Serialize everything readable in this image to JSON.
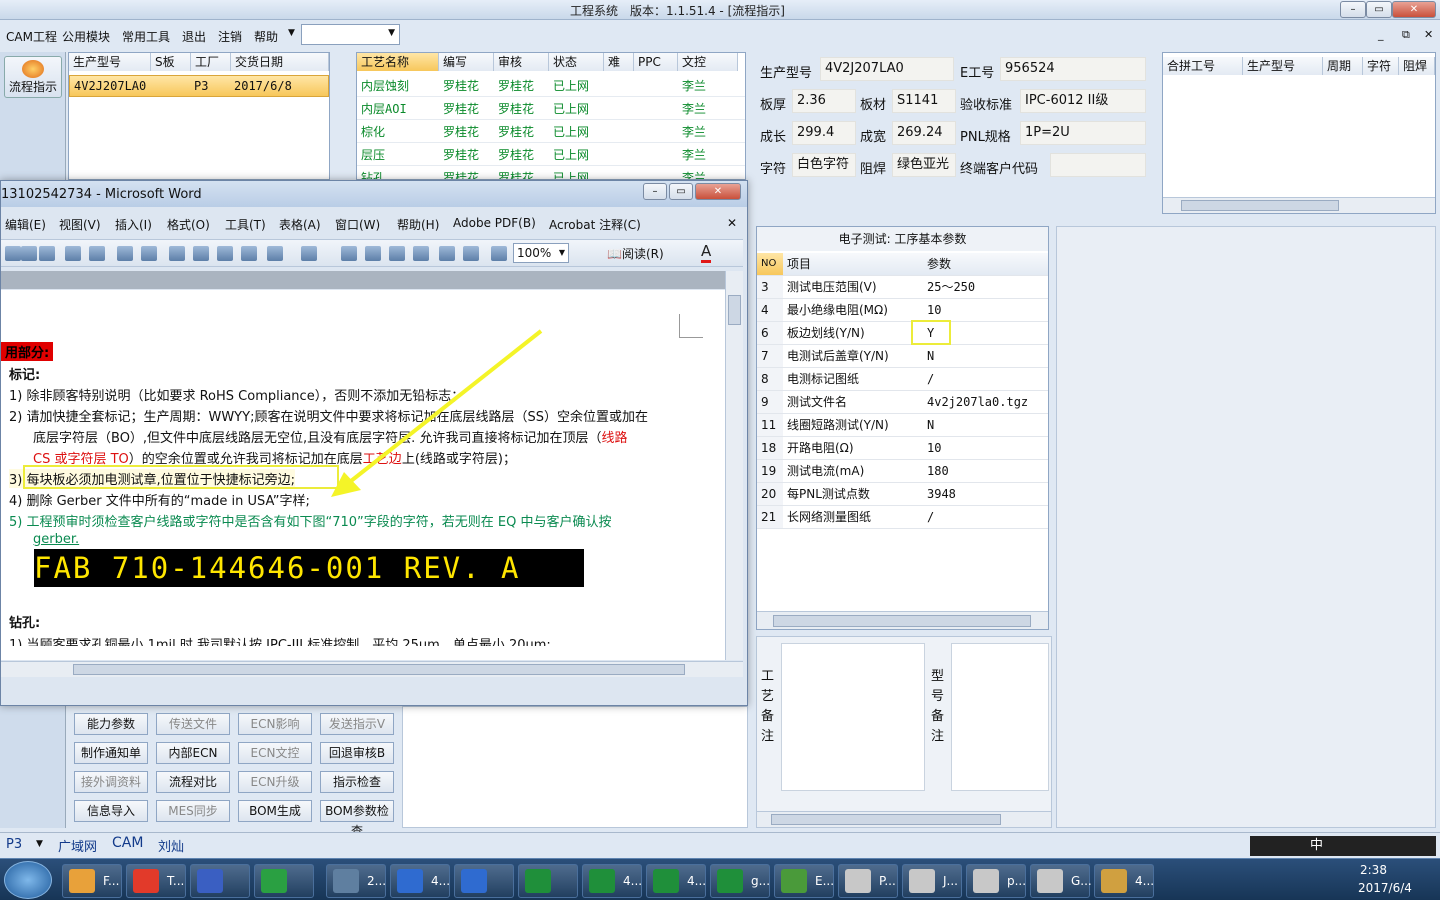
{
  "app": {
    "title": "工程系统　版本：1.1.51.4 - [流程指示]"
  },
  "menu": [
    "CAM工程",
    "公用模块",
    "常用工具",
    "退出",
    "注销",
    "帮助"
  ],
  "left_tool": {
    "flow_button": "流程指示"
  },
  "order_list": {
    "headers": [
      "生产型号",
      "S板",
      "工厂",
      "交货日期"
    ],
    "rows": [
      [
        "4V2J207LA0",
        "",
        "P3",
        "2017/6/8"
      ]
    ]
  },
  "process_list": {
    "headers": [
      "工艺名称",
      "编写",
      "审核",
      "状态",
      "难",
      "PPC",
      "文控"
    ],
    "rows": [
      [
        "内层蚀刻",
        "罗桂花",
        "罗桂花",
        "已上网",
        "",
        "",
        "李兰"
      ],
      [
        "内层AOI",
        "罗桂花",
        "罗桂花",
        "已上网",
        "",
        "",
        "李兰"
      ],
      [
        "棕化",
        "罗桂花",
        "罗桂花",
        "已上网",
        "",
        "",
        "李兰"
      ],
      [
        "层压",
        "罗桂花",
        "罗桂花",
        "已上网",
        "",
        "",
        "李兰"
      ],
      [
        "钻孔",
        "罗桂花",
        "罗桂花",
        "已上网",
        "",
        "",
        "李兰"
      ]
    ]
  },
  "info": {
    "model_label": "生产型号",
    "model": "4V2J207LA0",
    "eno_label": "E工号",
    "eno": "956524",
    "thick_label": "板厚",
    "thick": "2.36",
    "material_label": "板材",
    "material": "S1141",
    "std_label": "验收标准",
    "std": "IPC-6012 II级",
    "len_label": "成长",
    "len": "299.4",
    "wid_label": "成宽",
    "wid": "269.24",
    "pnl_label": "PNL规格",
    "pnl": "1P=2U",
    "char_label": "字符",
    "char": "白色字符",
    "mask_label": "阻焊",
    "mask": "绿色亚光",
    "cust_label": "终端客户代码",
    "cust": ""
  },
  "merge_list": {
    "headers": [
      "合拼工号",
      "生产型号",
      "周期",
      "字符",
      "阻焊"
    ]
  },
  "params": {
    "title": "电子测试: 工序基本参数",
    "headers": [
      "NO",
      "项目",
      "参数"
    ],
    "rows": [
      [
        "3",
        "测试电压范围(V)",
        "25～250"
      ],
      [
        "4",
        "最小绝缘电阻(MΩ)",
        "10"
      ],
      [
        "6",
        "板边划线(Y/N)",
        "Y"
      ],
      [
        "7",
        "电测试后盖章(Y/N)",
        "N"
      ],
      [
        "8",
        "电测标记图纸",
        "/"
      ],
      [
        "9",
        "测试文件名",
        "4v2j207la0.tgz"
      ],
      [
        "11",
        "线圈短路测试(Y/N)",
        "N"
      ],
      [
        "18",
        "开路电阻(Ω)",
        "10"
      ],
      [
        "19",
        "测试电流(mA)",
        "180"
      ],
      [
        "20",
        "每PNL测试点数",
        "3948"
      ],
      [
        "21",
        "长网络测量图纸",
        "/"
      ]
    ]
  },
  "remarks": {
    "process_label": "工艺备注",
    "model_label": "型号备注"
  },
  "word": {
    "title": "13102542734 - Microsoft Word",
    "menu": [
      "编辑(E)",
      "视图(V)",
      "插入(I)",
      "格式(O)",
      "工具(T)",
      "表格(A)",
      "窗口(W)",
      "帮助(H)",
      "Adobe PDF(B)",
      "Acrobat 注释(C)"
    ],
    "zoom": "100%",
    "read_button": "阅读(R)",
    "section_title": "用部分:",
    "mark_title": "标记:",
    "l1": "1)  除非顾客特别说明（比如要求 RoHS Compliance），否则不添加无铅标志；",
    "l2a": "2)  请加快捷全套标记；生产周期：WWYY;顾客在说明文件中要求将标记加在底层线路层（SS）空余位置或加在",
    "l2b": "底层字符层（BO）,但文件中底层线路层无空位,且没有底层字符层. 允许我司直接将标记加在顶层（",
    "l2b_red": "线路",
    "l2c_red": "CS 或字符层 TO",
    "l2c": "）的空余位置或允许我司将标记加在底层",
    "l2c_red2": "工艺边",
    "l2c_end": "上(线路或字符层)；",
    "l3": "3)  每块板必须加电测试章,位置位于快捷标记旁边;",
    "l4": "4)  删除 Gerber 文件中所有的“made in USA”字样;",
    "l5a": "5)  工程预审时须检查客户线路或字符中是否含有如下图“710”字段的字符，若无则在 EQ 中与客户确认按",
    "l5b": "gerber.",
    "banner": "FAB 710-144646-001 REV. A",
    "drill_title": "钻孔:",
    "l6": "1)  当顾客要求孔铜最小 1mil 时,我司默认按 IPC-III 标准控制，平均 25um，单点最小 20um;"
  },
  "bottom_buttons": [
    [
      "能力参数",
      "传送文件",
      "ECN影响",
      "发送指示V"
    ],
    [
      "制作通知单",
      "内部ECN",
      "ECN文控",
      "回退审核B"
    ],
    [
      "接外调资料",
      "流程对比",
      "ECN升级",
      "指示检查"
    ],
    [
      "信息导入",
      "MES同步",
      "BOM生成",
      "BOM参数检查"
    ]
  ],
  "status": {
    "factory": "P3",
    "items": [
      "广域网",
      "CAM",
      "刘灿"
    ]
  },
  "taskbar": {
    "items": [
      "F...",
      "T...",
      "",
      "",
      "2...",
      "4...",
      "",
      "",
      "4...",
      "4...",
      "g...",
      "E...",
      "P...",
      "J...",
      "p...",
      "G...",
      "4..."
    ],
    "time": "2:38",
    "date": "2017/6/4",
    "ime": "中"
  }
}
